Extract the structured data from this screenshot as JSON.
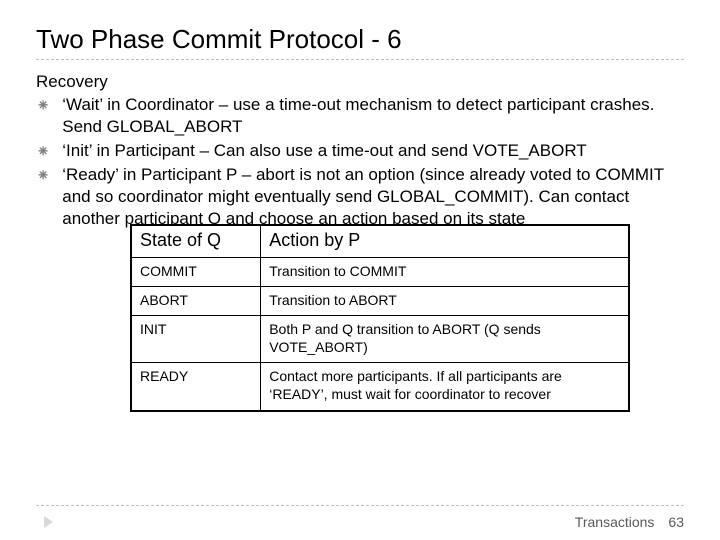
{
  "title": "Two Phase Commit Protocol - 6",
  "subhead": "Recovery",
  "bullets": [
    "‘Wait’ in Coordinator – use a time-out mechanism to detect participant crashes.  Send GLOBAL_ABORT",
    "‘Init’ in Participant – Can also use a time-out and send VOTE_ABORT",
    "‘Ready’ in Participant P – abort is not an option (since already voted to COMMIT and so coordinator might eventually send GLOBAL_COMMIT).  Can contact another participant Q and choose an action based on its state"
  ],
  "table": {
    "headers": [
      "State of Q",
      "Action by P"
    ],
    "rows": [
      {
        "state": "COMMIT",
        "action": "Transition to COMMIT"
      },
      {
        "state": "ABORT",
        "action": "Transition to ABORT"
      },
      {
        "state": "INIT",
        "action": "Both P and Q transition to ABORT (Q sends VOTE_ABORT)"
      },
      {
        "state": "READY",
        "action": "Contact more participants.  If all participants are ‘READY’, must wait for coordinator to recover"
      }
    ]
  },
  "footer": {
    "label": "Transactions",
    "page": "63"
  }
}
